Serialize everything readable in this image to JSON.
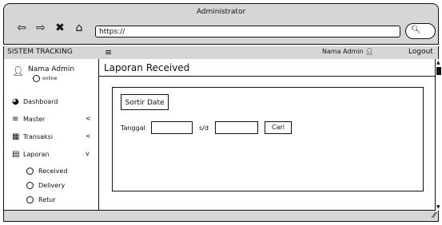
{
  "browser": {
    "title": "Administrator",
    "url": "https://",
    "icons": [
      "back-arrow-icon",
      "forward-arrow-icon",
      "close-icon",
      "home-icon",
      "search-icon"
    ]
  },
  "app": {
    "brand": "SISTEM TRACKING",
    "admin_name": "Nama Admin",
    "logout": "Logout"
  },
  "sidebar": {
    "user_name": "Nama Admin",
    "user_status": "online",
    "items": [
      {
        "label": "Dashboard",
        "icon": "dashboard-icon"
      },
      {
        "label": "Master",
        "icon": "menu-icon",
        "chevron": "<"
      },
      {
        "label": "Transaksi",
        "icon": "table-icon",
        "chevron": "<"
      },
      {
        "label": "Laporan",
        "icon": "calendar-icon",
        "chevron": "v"
      }
    ],
    "subitems": [
      "Received",
      "Delivery",
      "Retur"
    ]
  },
  "main": {
    "title": "Laporan Received",
    "sortir_label": "Sortir Date",
    "tanggal_label": "Tanggal",
    "sd_label": "s/d",
    "cari_label": "Cari"
  }
}
